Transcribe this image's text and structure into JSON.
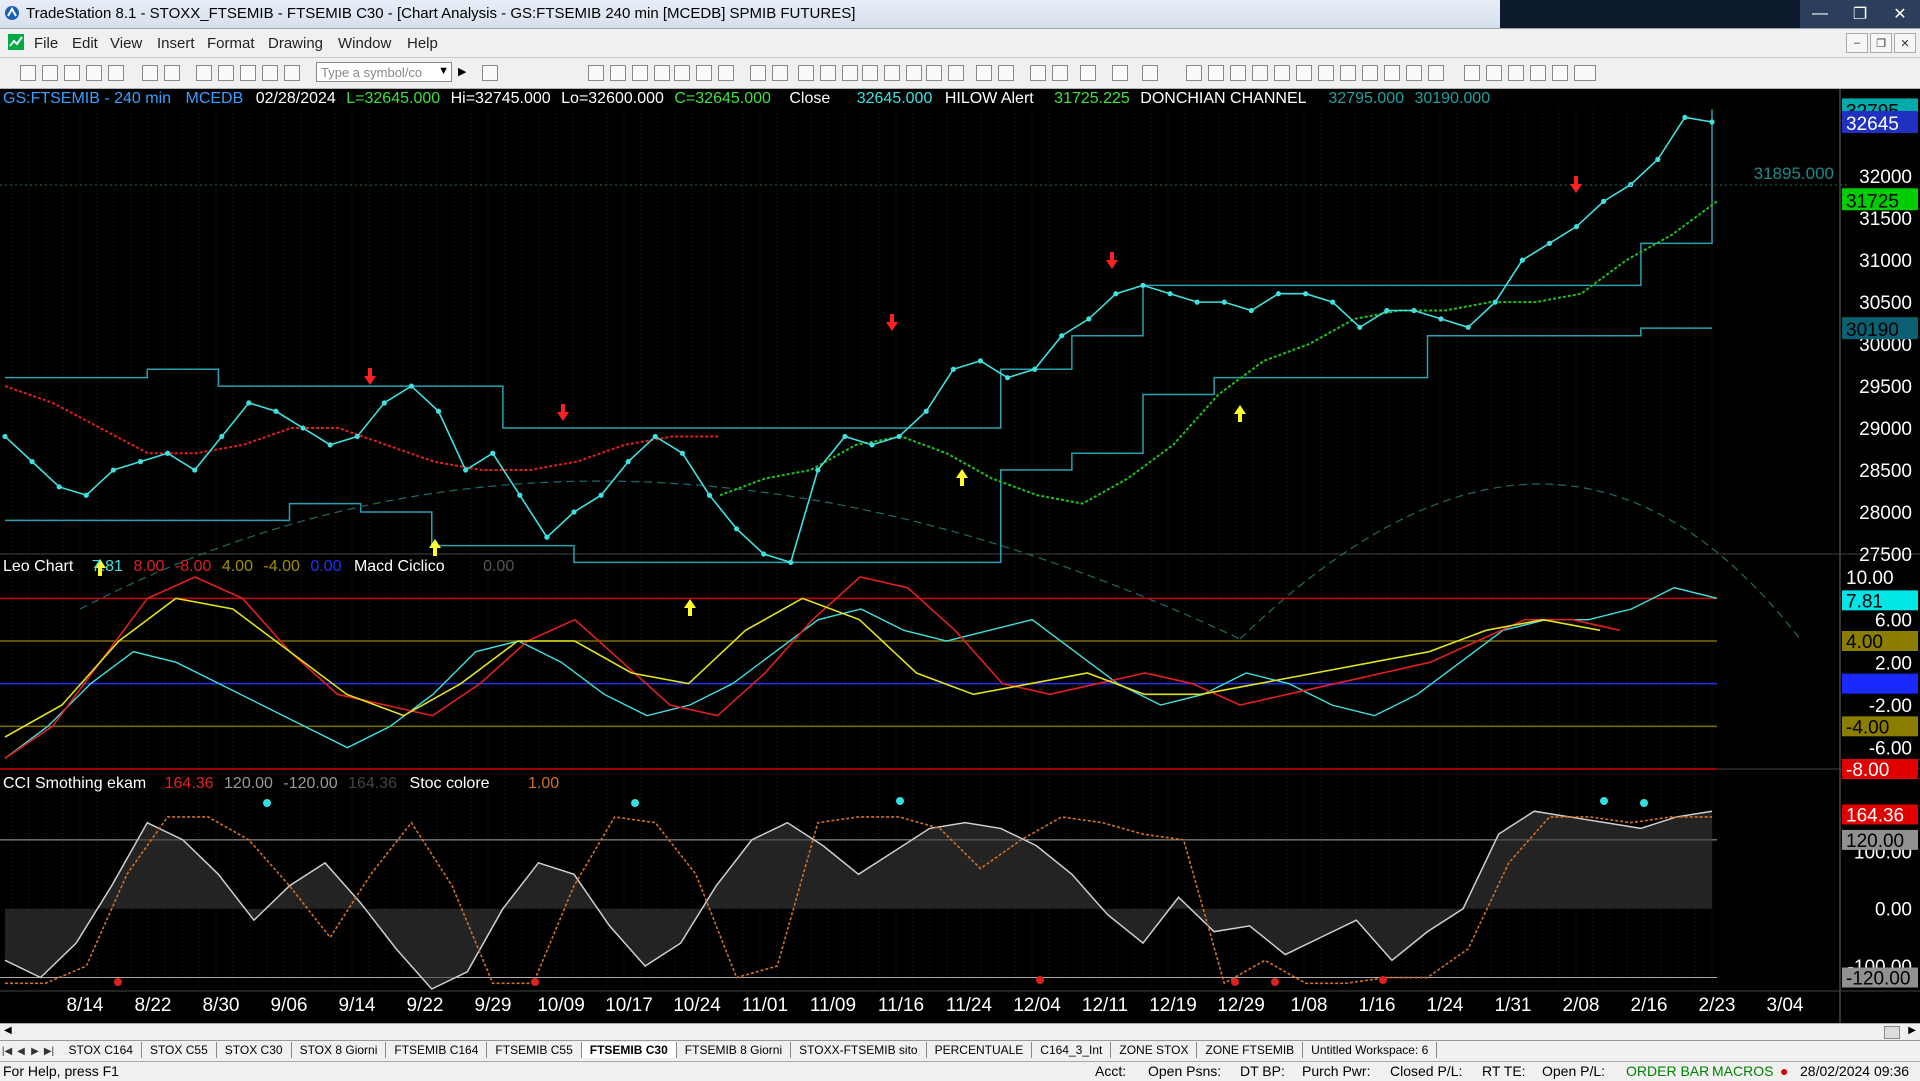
{
  "window": {
    "title": "TradeStation 8.1 - STOXX_FTSEMIB - FTSEMIB C30 - [Chart Analysis - GS:FTSEMIB  240 min  [MCEDB] SPMIB FUTURES]",
    "minimize": "—",
    "maximize": "❐",
    "close": "✕"
  },
  "menu": {
    "items": [
      "File",
      "Edit",
      "View",
      "Insert",
      "Format",
      "Drawing",
      "Window",
      "Help"
    ],
    "mdi_min": "–",
    "mdi_restore": "❐",
    "mdi_close": "✕"
  },
  "toolbar": {
    "symbol_placeholder": "Type a symbol/co"
  },
  "chart_data": [
    {
      "type": "line",
      "panel": "price",
      "header": {
        "symbol": "GS:FTSEMIB - 240 min",
        "source": "MCEDB",
        "date": "02/28/2024",
        "low": "L=32645.000",
        "high": "Hi=32745.000",
        "lo": "Lo=32600.000",
        "close_c": "C=32645.000",
        "close_label": "Close",
        "close_val": "32645.000",
        "alert_name": "HILOW Alert",
        "alert_val": "31725.225",
        "donchian_name": "DONCHIAN CHANNEL",
        "donchian_hi": "32795.000",
        "donchian_lo": "30190.000"
      },
      "price_line_label": "31895.000",
      "ylim": [
        27500,
        32800
      ],
      "y_ticks": [
        "32000",
        "31500",
        "31000",
        "30500",
        "30000",
        "29500",
        "29000",
        "28500",
        "28000",
        "27500"
      ],
      "right_tags": [
        {
          "text": "32795",
          "value": 32795,
          "bg": "#0aa",
          "fg": "#000"
        },
        {
          "text": "32645",
          "value": 32645,
          "bg": "#2030c0",
          "fg": "#fff"
        },
        {
          "text": "31725",
          "value": 31725,
          "bg": "#00cc00",
          "fg": "#000"
        },
        {
          "text": "30190",
          "value": 30190,
          "bg": "#0a6070",
          "fg": "#000"
        }
      ],
      "x_ticks": [
        "8/14",
        "8/22",
        "8/30",
        "9/06",
        "9/14",
        "9/22",
        "9/29",
        "10/09",
        "10/17",
        "10/24",
        "11/01",
        "11/09",
        "11/16",
        "11/24",
        "12/04",
        "12/11",
        "12/19",
        "12/29",
        "1/08",
        "1/16",
        "1/24",
        "1/31",
        "2/08",
        "2/16",
        "2/23",
        "3/04"
      ],
      "series": [
        {
          "values": [
            28900,
            28600,
            28300,
            28200,
            28500,
            28600,
            28700,
            28500,
            28900,
            29300,
            29200,
            29000,
            28800,
            28900,
            29300,
            29500,
            29200,
            28500,
            28700,
            28200,
            27700,
            28000,
            28200,
            28600,
            28900,
            28700,
            28200,
            27800,
            27500,
            27400,
            28500,
            28900,
            28800,
            28900,
            29200,
            29700,
            29800,
            29600,
            29700,
            30100,
            30300,
            30600,
            30700,
            30600,
            30500,
            30500,
            30400,
            30600,
            30600,
            30500,
            30200,
            30400,
            30400,
            30300,
            30200,
            30500,
            31000,
            31200,
            31400,
            31700,
            31900,
            32200,
            32700,
            32645
          ]
        },
        {
          "values": [
            29500,
            29300,
            29000,
            28700,
            28700,
            28800,
            29000,
            29000,
            28800,
            28600,
            28500,
            28500,
            28600,
            28800,
            28900,
            28900
          ]
        },
        {
          "values": [
            28200,
            28400,
            28500,
            28800,
            28900,
            28700,
            28400,
            28200,
            28100,
            28400,
            28800,
            29400,
            29800,
            30000,
            30300,
            30400,
            30400,
            30500,
            30500,
            30600,
            31000,
            31300,
            31700
          ]
        }
      ]
    },
    {
      "type": "line",
      "panel": "leo",
      "header": {
        "name": "Leo Chart",
        "v1": "7.81",
        "v2": "8.00",
        "v3": "-8.00",
        "v4": "4.00",
        "v5": "-4.00",
        "v6": "0.00",
        "name2": "Macd Ciclico",
        "v7": "0.00"
      },
      "ylim": [
        -8,
        10
      ],
      "y_ticks": [
        "6.00",
        "2.00",
        "-2.00",
        "-6.00"
      ],
      "right_tags": [
        {
          "text": "10.00",
          "value": 10,
          "bg": "#000",
          "fg": "#fff"
        },
        {
          "text": "7.81",
          "value": 7.81,
          "bg": "#00e5e5",
          "fg": "#000"
        },
        {
          "text": "4.00",
          "value": 4,
          "bg": "#8a7d00",
          "fg": "#000"
        },
        {
          "text": "0.00",
          "value": 0,
          "bg": "#1a2aff",
          "fg": "#1a2aff"
        },
        {
          "text": "-4.00",
          "value": -4,
          "bg": "#8a7d00",
          "fg": "#000"
        },
        {
          "text": "-8.00",
          "value": -8,
          "bg": "#e00000",
          "fg": "#fff"
        }
      ],
      "series": [
        {
          "values": [
            -7,
            -4,
            0,
            3,
            2,
            0,
            -2,
            -4,
            -6,
            -4,
            -1,
            3,
            4,
            2,
            -1,
            -3,
            -2,
            0,
            3,
            6,
            7,
            5,
            4,
            5,
            6,
            3,
            0,
            -2,
            -1,
            1,
            0,
            -2,
            -3,
            -1,
            2,
            5,
            6,
            6,
            7,
            9,
            8
          ]
        },
        {
          "values": [
            -7,
            -4,
            2,
            8,
            10,
            8,
            3,
            -1,
            -2,
            -3,
            0,
            4,
            6,
            2,
            -2,
            -3,
            1,
            6,
            10,
            9,
            5,
            0,
            -1,
            0,
            1,
            0,
            -2,
            -1,
            0,
            1,
            2,
            4,
            6,
            6,
            5
          ]
        },
        {
          "values": [
            -5,
            -2,
            4,
            8,
            7,
            3,
            -1,
            -3,
            0,
            4,
            4,
            1,
            0,
            5,
            8,
            6,
            1,
            -1,
            0,
            1,
            -1,
            -1,
            0,
            1,
            2,
            3,
            5,
            6,
            5
          ]
        }
      ]
    },
    {
      "type": "area",
      "panel": "cci",
      "header": {
        "name": "CCI Smothing ekam",
        "v1": "164.36",
        "v2": "120.00",
        "v3": "-120.00",
        "v4": "164.36",
        "name2": "Stoc colore",
        "v5": "1.00"
      },
      "ylim": [
        -140,
        200
      ],
      "y_ticks": [
        "100.00",
        "0.00",
        "-100.00"
      ],
      "right_tags": [
        {
          "text": "164.36",
          "value": 164.36,
          "bg": "#e00000",
          "fg": "#fff"
        },
        {
          "text": "120.00",
          "value": 120,
          "bg": "#909090",
          "fg": "#000"
        },
        {
          "text": "-120.00",
          "value": -120,
          "bg": "#909090",
          "fg": "#000"
        }
      ],
      "series": [
        {
          "values": [
            -90,
            -120,
            -60,
            40,
            150,
            120,
            60,
            -20,
            40,
            80,
            10,
            -70,
            -140,
            -110,
            0,
            80,
            60,
            -30,
            -100,
            -60,
            40,
            120,
            150,
            110,
            60,
            100,
            140,
            150,
            140,
            110,
            60,
            -10,
            -60,
            20,
            -40,
            -30,
            -80,
            -50,
            -20,
            -90,
            -40,
            0,
            130,
            170,
            160,
            150,
            140,
            160,
            170
          ]
        },
        {
          "values": [
            -130,
            -130,
            -100,
            60,
            160,
            160,
            120,
            40,
            -50,
            60,
            150,
            40,
            -130,
            -130,
            40,
            160,
            150,
            60,
            -120,
            -100,
            150,
            160,
            160,
            140,
            70,
            120,
            160,
            150,
            130,
            120,
            -130,
            -90,
            -130,
            -130,
            -120,
            -120,
            -70,
            80,
            160,
            160,
            150,
            160,
            160
          ]
        }
      ]
    }
  ],
  "tabs": {
    "items": [
      "STOX C164",
      "STOX C55",
      "STOX C30",
      "STOX 8 Giorni",
      "FTSEMIB C164",
      "FTSEMIB C55",
      "FTSEMIB C30",
      "FTSEMIB 8 Giorni",
      "STOXX-FTSEMIB sito",
      "PERCENTUALE",
      "C164_3_Int",
      "ZONE STOX",
      "ZONE FTSEMIB",
      "Untitled Workspace: 6"
    ],
    "active": "FTSEMIB C30"
  },
  "status": {
    "help": "For Help, press F1",
    "acct": "Acct:",
    "open_psns": "Open Psns:",
    "dt_bp": "DT BP:",
    "purch_pwr": "Purch Pwr:",
    "closed_pl": "Closed P/L:",
    "rt_te": "RT TE:",
    "open_pl": "Open P/L:",
    "order_bar": "ORDER BAR",
    "macros": "MACROS",
    "datetime": "28/02/2024 09:36"
  },
  "colors": {
    "price": "#40e0e0",
    "ma_red": "#e02020",
    "ma_green": "#20c020",
    "donchian": "#2aa0b0",
    "leo_cyan": "#40e0e0",
    "leo_red": "#e02020",
    "leo_yellow": "#e0e020",
    "cci_white": "#d0d0d0",
    "cci_orange": "#d0702a",
    "grid": "#2a4a2a"
  }
}
